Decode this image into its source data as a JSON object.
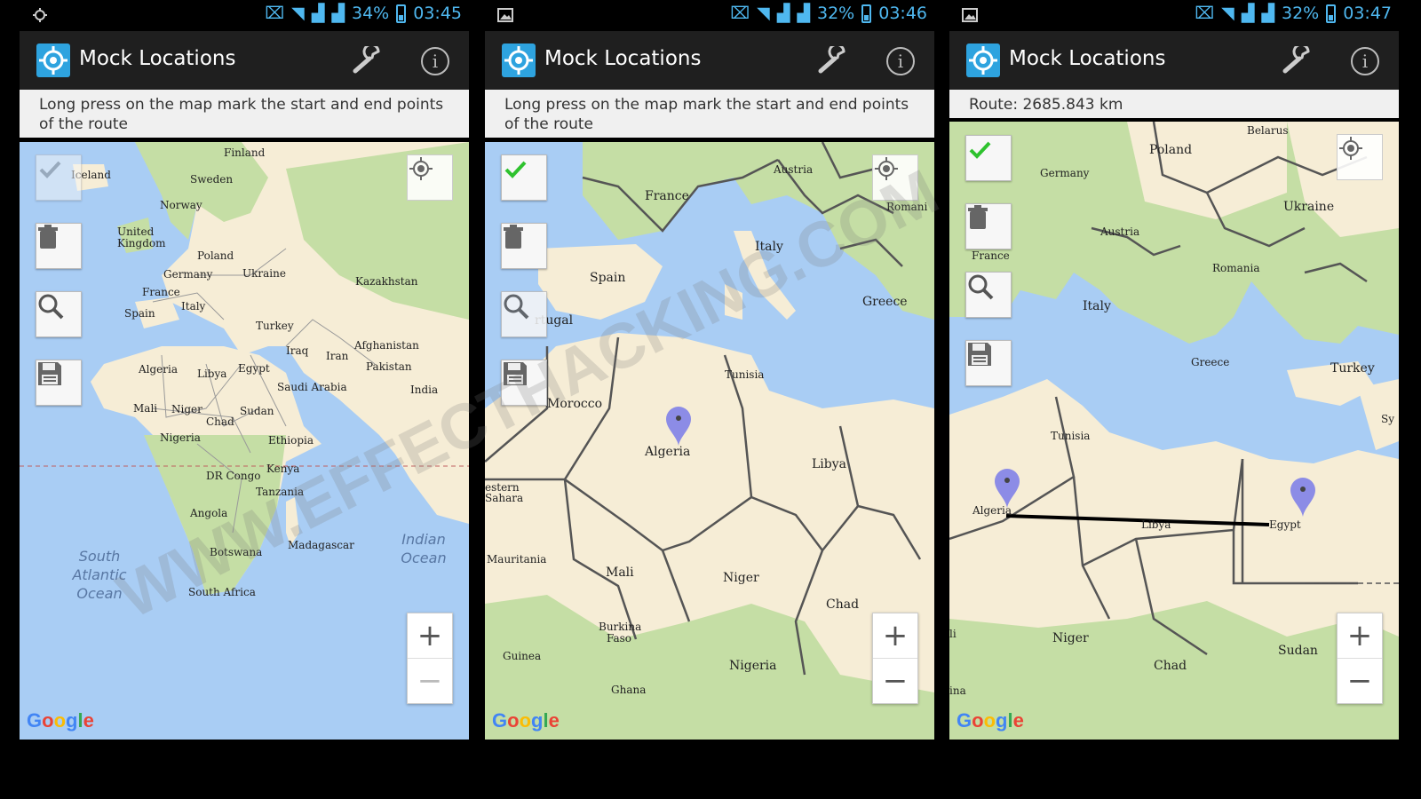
{
  "panels": [
    {
      "status": {
        "battery": "34%",
        "time": "03:45"
      },
      "app_title": "Mock Locations",
      "hint": "Long press on the map mark the start and end points of the route",
      "labels": {
        "finland": "Finland",
        "iceland": "Iceland",
        "sweden": "Sweden",
        "norway": "Norway",
        "uk": "United Kingdom",
        "poland": "Poland",
        "germany": "Germany",
        "ukraine": "Ukraine",
        "kazakhstan": "Kazakhstan",
        "france": "France",
        "italy": "Italy",
        "spain": "Spain",
        "turkey": "Turkey",
        "afghanistan": "Afghanistan",
        "iraq": "Iraq",
        "iran": "Iran",
        "pakistan": "Pakistan",
        "algeria": "Algeria",
        "libya": "Libya",
        "egypt": "Egypt",
        "saudi": "Saudi Arabia",
        "india": "India",
        "mali": "Mali",
        "niger": "Niger",
        "chad": "Chad",
        "sudan": "Sudan",
        "nigeria": "Nigeria",
        "ethiopia": "Ethiopia",
        "kenya": "Kenya",
        "drc": "DR Congo",
        "tanzania": "Tanzania",
        "angola": "Angola",
        "madagascar": "Madagascar",
        "botswana": "Botswana",
        "south_africa": "South Africa",
        "south_atlantic": "South Atlantic Ocean",
        "indian_ocean": "Indian Ocean"
      },
      "google": "Google"
    },
    {
      "status": {
        "battery": "32%",
        "time": "03:46"
      },
      "app_title": "Mock Locations",
      "hint": "Long press on the map mark the start and end points of the route",
      "labels": {
        "france": "France",
        "austria": "Austria",
        "romania": "Romani",
        "italy": "Italy",
        "spain": "Spain",
        "portugal": "rtugal",
        "greece": "Greece",
        "tunisia": "Tunisia",
        "morocco": "Morocco",
        "algeria": "Algeria",
        "libya": "Libya",
        "western_sahara": "estern Sahara",
        "mauritania": "Mauritania",
        "mali": "Mali",
        "niger": "Niger",
        "chad": "Chad",
        "burkina": "Burkina Faso",
        "guinea": "Guinea",
        "nigeria": "Nigeria",
        "ghana": "Ghana"
      },
      "google": "Google"
    },
    {
      "status": {
        "battery": "32%",
        "time": "03:47"
      },
      "app_title": "Mock Locations",
      "hint": "Route: 2685.843 km",
      "labels": {
        "belarus": "Belarus",
        "poland": "Poland",
        "germany": "Germany",
        "ukraine": "Ukraine",
        "austria": "Austria",
        "france": "France",
        "romania": "Romania",
        "italy": "Italy",
        "greece": "Greece",
        "turkey": "Turkey",
        "sy": "Sy",
        "tunisia": "Tunisia",
        "algeria": "Algeria",
        "libya": "Libya",
        "egypt": "Egypt",
        "niger": "Niger",
        "chad": "Chad",
        "sudan": "Sudan",
        "li": "li",
        "ina": "ina"
      },
      "google": "Google"
    }
  ],
  "watermark": "WWW.EFFECTHACKING.COM",
  "colors": {
    "water": "#a9cdf4",
    "land": "#f6edd6",
    "green": "#c5dea5",
    "action_bar": "#1f1f1f",
    "status_icon": "#4fb8f0",
    "pin": "#8c8ce6",
    "check": "#2ec22e"
  }
}
